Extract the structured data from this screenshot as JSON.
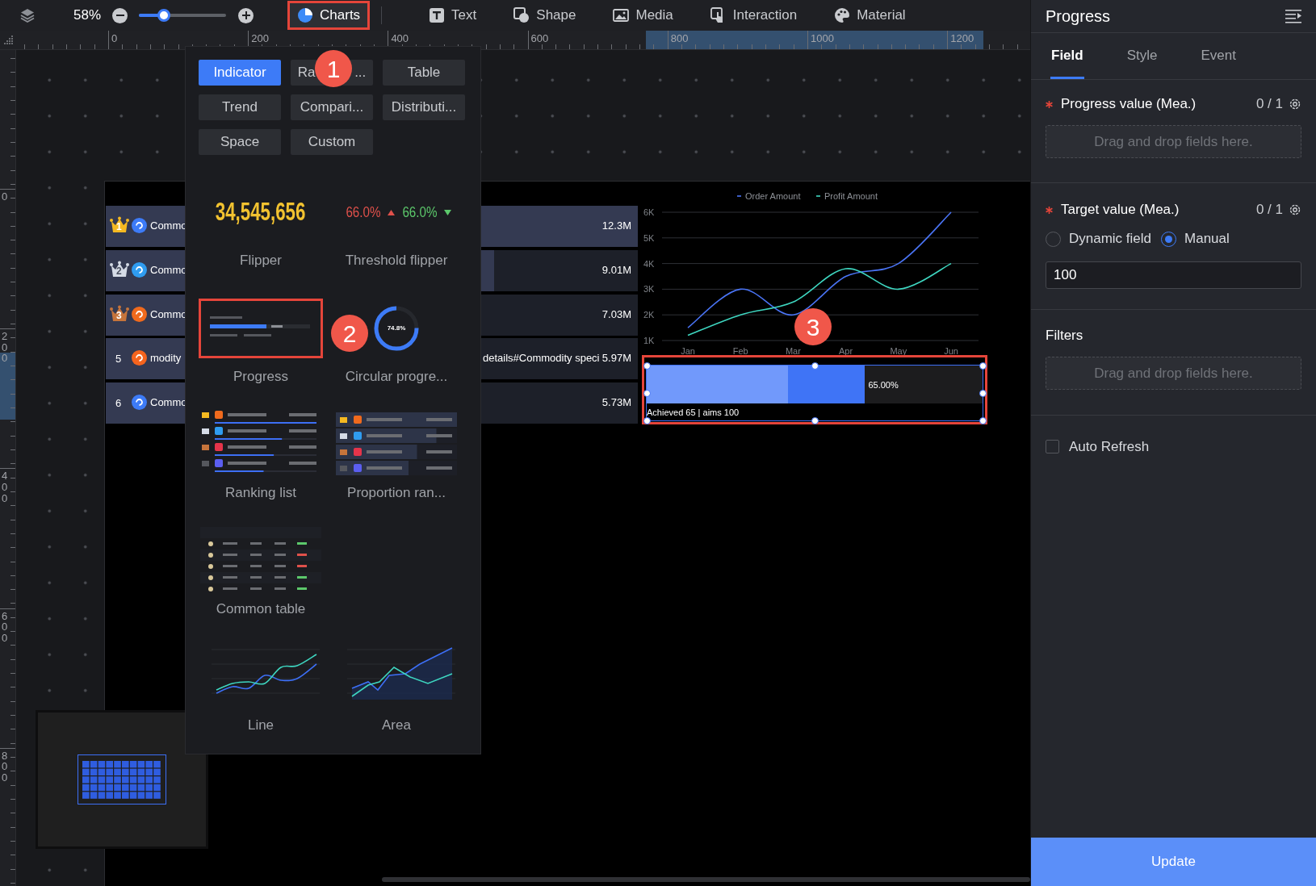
{
  "toolbar": {
    "zoom": "58%",
    "zoom_slider": {
      "level": 0.25
    },
    "tools": [
      {
        "kind": "charts",
        "label": "Charts",
        "selected": true,
        "highlighted": true
      },
      {
        "kind": "text",
        "label": "Text",
        "selected": false,
        "highlighted": false
      },
      {
        "kind": "shape",
        "label": "Shape",
        "selected": false,
        "highlighted": false
      },
      {
        "kind": "media",
        "label": "Media",
        "selected": false,
        "highlighted": false
      },
      {
        "kind": "interaction",
        "label": "Interaction",
        "selected": false,
        "highlighted": false
      },
      {
        "kind": "material",
        "label": "Material",
        "selected": false,
        "highlighted": false
      }
    ]
  },
  "rulers": {
    "horizontal": [
      "0",
      "200",
      "400",
      "600",
      "800",
      "1000",
      "1200"
    ],
    "vertical": [
      "0",
      "200",
      "400",
      "600",
      "800"
    ]
  },
  "chart_menu": {
    "categories": [
      {
        "label": "Indicator",
        "selected": true
      },
      {
        "label": "Ra ...",
        "selected": false
      },
      {
        "label": "Table",
        "selected": false
      },
      {
        "label": "Trend",
        "selected": false
      },
      {
        "label": "Compari...",
        "selected": false
      },
      {
        "label": "Distributi...",
        "selected": false
      },
      {
        "label": "Space",
        "selected": false
      },
      {
        "label": "Custom",
        "selected": false
      }
    ],
    "rows": [
      [
        {
          "kind": "flipper",
          "label": "Flipper",
          "highlighted": false,
          "preview": {
            "value": "34,545,656"
          }
        },
        {
          "kind": "threshold",
          "label": "Threshold flipper",
          "highlighted": false,
          "preview": [
            {
              "value": "66.0%",
              "rising": true
            },
            {
              "value": "66.0%",
              "rising": false
            }
          ]
        }
      ],
      [
        {
          "kind": "progress",
          "label": "Progress",
          "highlighted": true
        },
        {
          "kind": "circular",
          "label": "Circular progre...",
          "highlighted": false,
          "preview": {
            "value": "74.8%",
            "level": 0.748
          }
        }
      ],
      [
        {
          "kind": "ranking",
          "label": "Ranking list",
          "highlighted": false
        },
        {
          "kind": "proportion",
          "label": "Proportion ran...",
          "highlighted": false
        }
      ],
      [
        {
          "kind": "table",
          "label": "Common table",
          "highlighted": false
        }
      ],
      [
        {
          "kind": "line",
          "label": "Line",
          "highlighted": false
        },
        {
          "kind": "area",
          "label": "Area",
          "highlighted": false
        }
      ]
    ]
  },
  "canvas": {
    "ranking": [
      {
        "crown": {
          "color": "#f5b921"
        },
        "rank": "1",
        "color": "#3d7bf7",
        "name": "Commo",
        "value": "12.3M",
        "level": 1.0
      },
      {
        "crown": {
          "color": "#d5dbe6"
        },
        "rank": "2",
        "color": "#2f9cf0",
        "name": "Commo",
        "value": "9.01M",
        "level": 0.73
      },
      {
        "crown": {
          "color": "#c6743b"
        },
        "rank": "3",
        "color": "#f06a1d",
        "name": "Commo",
        "value": "7.03M",
        "level": 0.57
      },
      {
        "rank": "5",
        "color": "#f5641e",
        "name": "modity",
        "detail": "details#Commodity speci",
        "value": "5.97M",
        "level": 0.485
      },
      {
        "rank": "6",
        "color": "#3d7bf7",
        "name": "Commo",
        "value": "5.73M",
        "level": 0.466
      }
    ],
    "line_chart": {
      "chart_data": {
        "type": "line",
        "categories": [
          "Jan",
          "Feb",
          "Mar",
          "Apr",
          "May",
          "Jun"
        ],
        "series": [
          {
            "name": "Order Amount",
            "color": "#4a74f5",
            "values": [
              1500,
              3000,
              2000,
              3500,
              4000,
              6000
            ]
          },
          {
            "name": "Profit Amount",
            "color": "#3ed6c0",
            "values": [
              1200,
              2000,
              2500,
              3800,
              3000,
              4000
            ]
          }
        ],
        "ylim": [
          1000,
          6000
        ],
        "yticks": [
          {
            "value": 1000,
            "label": "1K"
          },
          {
            "value": 2000,
            "label": "2K"
          },
          {
            "value": 3000,
            "label": "3K"
          },
          {
            "value": 4000,
            "label": "4K"
          },
          {
            "value": 5000,
            "label": "5K"
          },
          {
            "value": 6000,
            "label": "6K"
          }
        ],
        "grid": true,
        "legend": true
      }
    },
    "progress_widget": {
      "level": 0.65,
      "value": "65.00%",
      "caption": "Achieved 65 | aims 100",
      "selected": true,
      "highlighted": true
    }
  },
  "annotations": [
    "1",
    "2",
    "3"
  ],
  "panel": {
    "title": "Progress",
    "tabs": [
      {
        "label": "Field",
        "selected": true
      },
      {
        "label": "Style",
        "selected": false
      },
      {
        "label": "Event",
        "selected": false
      }
    ],
    "progress_value": {
      "required": true,
      "label": "Progress value (Mea.)",
      "count": "0 / 1",
      "drop_hint": "Drag and drop fields here."
    },
    "target_value": {
      "required": true,
      "label": "Target value (Mea.)",
      "count": "0 / 1",
      "options": [
        {
          "label": "Dynamic field",
          "selected": false
        },
        {
          "label": "Manual",
          "selected": true
        }
      ],
      "value": "100"
    },
    "filters": {
      "title": "Filters",
      "drop_hint": "Drag and drop fields here."
    },
    "auto_refresh": {
      "label": "Auto Refresh",
      "checked": false
    },
    "update_button": "Update"
  }
}
